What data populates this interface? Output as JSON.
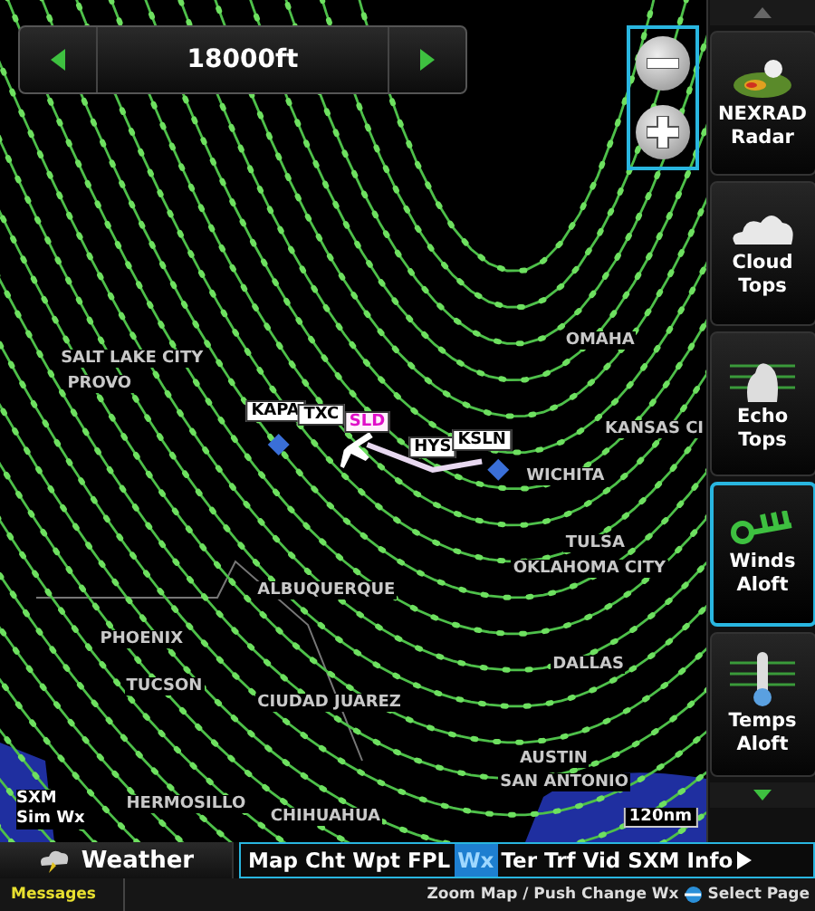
{
  "altitude_selector": {
    "value": "18000ft"
  },
  "map": {
    "cities": [
      {
        "name": "SALT LAKE CITY"
      },
      {
        "name": "PROVO"
      },
      {
        "name": "OMAHA"
      },
      {
        "name": "KANSAS CI"
      },
      {
        "name": "WICHITA"
      },
      {
        "name": "TULSA"
      },
      {
        "name": "OKLAHOMA CITY"
      },
      {
        "name": "ALBUQUERQUE"
      },
      {
        "name": "PHOENIX"
      },
      {
        "name": "DALLAS"
      },
      {
        "name": "TUCSON"
      },
      {
        "name": "CIUDAD JUAREZ"
      },
      {
        "name": "AUSTIN"
      },
      {
        "name": "SAN ANTONIO"
      },
      {
        "name": "HERMOSILLO"
      },
      {
        "name": "CHIHUAHUA"
      }
    ],
    "waypoints": [
      {
        "id": "KAPA",
        "active": false
      },
      {
        "id": "TXC",
        "active": false
      },
      {
        "id": "SLD",
        "active": true
      },
      {
        "id": "HYS",
        "active": false
      },
      {
        "id": "KSLN",
        "active": false
      }
    ],
    "source_label": [
      "SXM",
      "Sim Wx"
    ],
    "scale": "120nm"
  },
  "layers": [
    {
      "kind": "nexrad",
      "lines": [
        "NEXRAD",
        "Radar"
      ],
      "selected": false
    },
    {
      "kind": "cloud",
      "lines": [
        "Cloud",
        "Tops"
      ],
      "selected": false
    },
    {
      "kind": "echo",
      "lines": [
        "Echo",
        "Tops"
      ],
      "selected": false
    },
    {
      "kind": "winds",
      "lines": [
        "Winds",
        "Aloft"
      ],
      "selected": true
    },
    {
      "kind": "temps",
      "lines": [
        "Temps",
        "Aloft"
      ],
      "selected": false
    }
  ],
  "page_title": "Weather",
  "page_tabs": [
    {
      "label": "Map",
      "selected": false
    },
    {
      "label": "Cht",
      "selected": false
    },
    {
      "label": "Wpt",
      "selected": false
    },
    {
      "label": "FPL",
      "selected": false
    },
    {
      "label": "Wx",
      "selected": true
    },
    {
      "label": "Ter",
      "selected": false
    },
    {
      "label": "Trf",
      "selected": false
    },
    {
      "label": "Vid",
      "selected": false
    },
    {
      "label": "SXM",
      "selected": false
    },
    {
      "label": "Info",
      "selected": false
    }
  ],
  "status_bar": {
    "messages": "Messages",
    "hint": "Zoom Map / Push Change Wx",
    "select": "Select Page"
  }
}
